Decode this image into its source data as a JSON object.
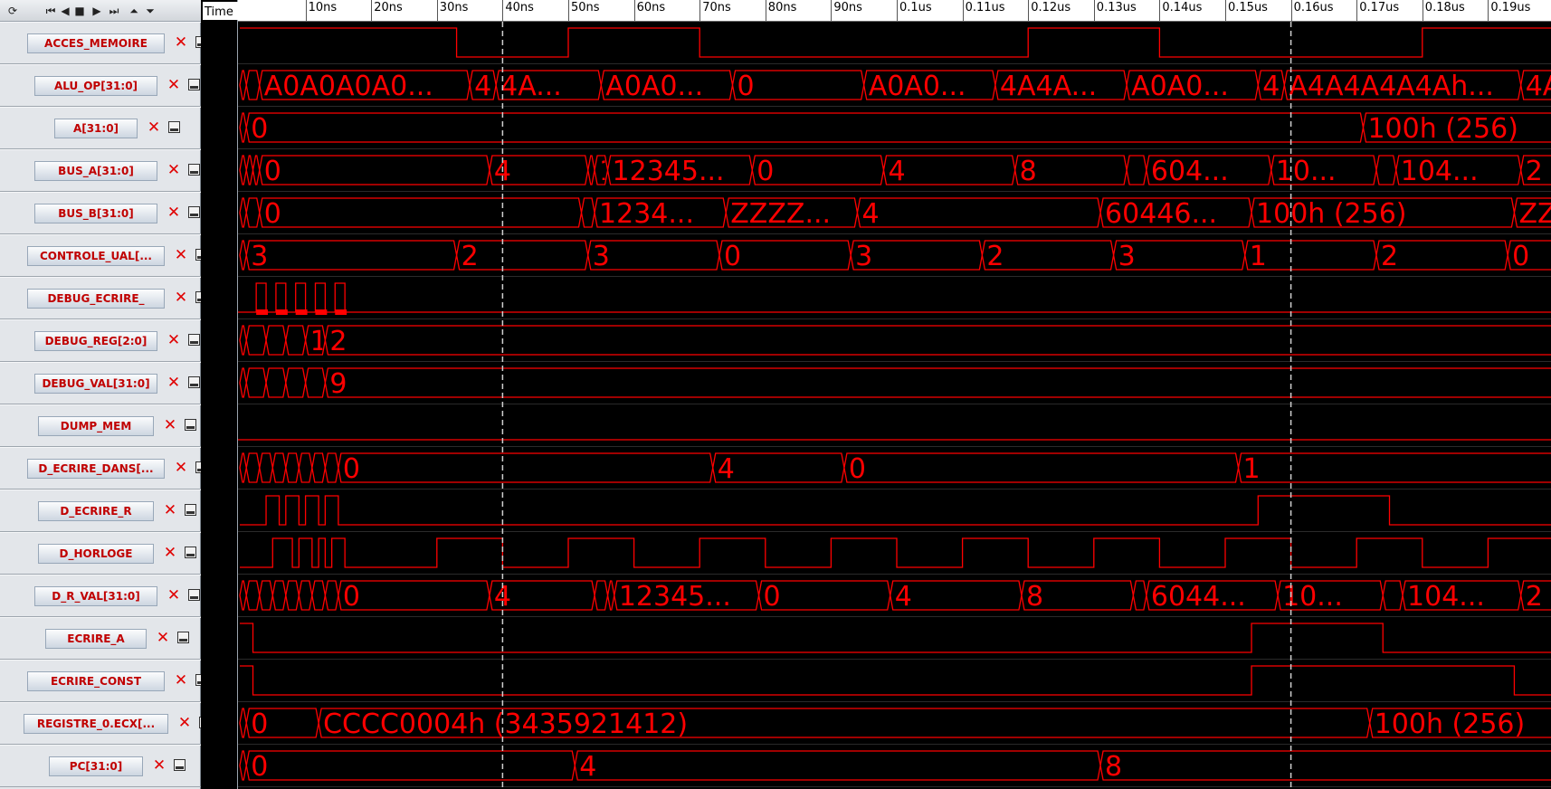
{
  "toolbar": {
    "buttons": [
      {
        "name": "refresh-icon",
        "glyph": "⟳"
      },
      {
        "name": "first-icon",
        "glyph": "⏮"
      },
      {
        "name": "prev-icon",
        "glyph": "◀"
      },
      {
        "name": "stop-icon",
        "glyph": "■"
      },
      {
        "name": "next-icon",
        "glyph": "▶"
      },
      {
        "name": "last-icon",
        "glyph": "⏭"
      },
      {
        "name": "move-up-icon",
        "glyph": "⏶"
      },
      {
        "name": "move-down-icon",
        "glyph": "⏷"
      }
    ]
  },
  "ruler": {
    "time_label": "Time",
    "ticks": [
      "10ns",
      "20ns",
      "30ns",
      "40ns",
      "50ns",
      "60ns",
      "70ns",
      "80ns",
      "90ns",
      "0.1us",
      "0.11us",
      "0.12us",
      "0.13us",
      "0.14us",
      "0.15us",
      "0.16us",
      "0.17us",
      "0.18us",
      "0.19us"
    ]
  },
  "time_range_ns": [
    0,
    205
  ],
  "cursors_ns": [
    40,
    160
  ],
  "colors": {
    "wave": "#ff0000",
    "background": "#000000",
    "label": "#c00000"
  },
  "signals": [
    {
      "name": "ACCES_MEMOIRE",
      "type": "bit",
      "edges": [
        [
          0,
          1
        ],
        [
          33,
          0
        ],
        [
          50,
          1
        ],
        [
          70,
          0
        ],
        [
          120,
          1
        ],
        [
          140,
          0
        ],
        [
          180,
          1
        ]
      ]
    },
    {
      "name": "ALU_OP[31:0]",
      "type": "bus",
      "segments": [
        [
          0,
          1,
          ""
        ],
        [
          1,
          3,
          ""
        ],
        [
          3,
          35,
          "A0A0A0A0A0A0A0A0h"
        ],
        [
          35,
          39,
          "4"
        ],
        [
          39,
          55,
          "4A4A4A4Ah"
        ],
        [
          55,
          75,
          "A0A0A0A0h"
        ],
        [
          75,
          95,
          "0"
        ],
        [
          95,
          115,
          "A0A0A0A0h"
        ],
        [
          115,
          135,
          "4A4A4A4Ah"
        ],
        [
          135,
          155,
          "A0A0A0A0h"
        ],
        [
          155,
          159,
          "4"
        ],
        [
          159,
          195,
          "A4A4A4A4Ah (2764...)"
        ],
        [
          195,
          205,
          "4A"
        ]
      ]
    },
    {
      "name": "A[31:0]",
      "type": "bus",
      "segments": [
        [
          0,
          1,
          ""
        ],
        [
          1,
          171,
          "0"
        ],
        [
          171,
          205,
          "100h (256)"
        ]
      ]
    },
    {
      "name": "BUS_A[31:0]",
      "type": "bus",
      "segments": [
        [
          0,
          1,
          ""
        ],
        [
          1,
          2,
          ""
        ],
        [
          2,
          3,
          ""
        ],
        [
          3,
          38,
          "0"
        ],
        [
          38,
          53,
          "4"
        ],
        [
          53,
          54,
          ""
        ],
        [
          54,
          56,
          "12345678h"
        ],
        [
          56,
          78,
          "12345678h"
        ],
        [
          78,
          98,
          "0"
        ],
        [
          98,
          118,
          "4"
        ],
        [
          118,
          135,
          "8"
        ],
        [
          135,
          138,
          ""
        ],
        [
          138,
          157,
          "60446044h"
        ],
        [
          157,
          173,
          "100h (256)"
        ],
        [
          173,
          176,
          ""
        ],
        [
          176,
          195,
          "104h (260)"
        ],
        [
          195,
          205,
          "2"
        ]
      ]
    },
    {
      "name": "BUS_B[31:0]",
      "type": "bus",
      "segments": [
        [
          0,
          1,
          ""
        ],
        [
          1,
          3,
          ""
        ],
        [
          3,
          52,
          "0"
        ],
        [
          52,
          54,
          ""
        ],
        [
          54,
          74,
          "12345678h"
        ],
        [
          74,
          94,
          "ZZZZZZZZh"
        ],
        [
          94,
          131,
          "4"
        ],
        [
          131,
          154,
          "60446044h"
        ],
        [
          154,
          194,
          "100h (256)"
        ],
        [
          194,
          205,
          "ZZ"
        ]
      ]
    },
    {
      "name": "CONTROLE_UAL[2:0]",
      "type": "bus",
      "segments": [
        [
          0,
          1,
          ""
        ],
        [
          1,
          33,
          "3"
        ],
        [
          33,
          53,
          "2"
        ],
        [
          53,
          73,
          "3"
        ],
        [
          73,
          93,
          "0"
        ],
        [
          93,
          113,
          "3"
        ],
        [
          113,
          133,
          "2"
        ],
        [
          133,
          153,
          "3"
        ],
        [
          153,
          173,
          "1"
        ],
        [
          173,
          193,
          "2"
        ],
        [
          193,
          205,
          "0"
        ]
      ]
    },
    {
      "name": "DEBUG_ECRIRE_",
      "type": "pulse",
      "pulses": [
        [
          2.5,
          4
        ],
        [
          5.5,
          7
        ],
        [
          8.5,
          10
        ],
        [
          11.5,
          13
        ],
        [
          14.5,
          16
        ]
      ]
    },
    {
      "name": "DEBUG_REG[2:0]",
      "type": "bus",
      "segments": [
        [
          0,
          1,
          ""
        ],
        [
          1,
          4,
          ""
        ],
        [
          4,
          7,
          ""
        ],
        [
          7,
          10,
          ""
        ],
        [
          10,
          13,
          "1"
        ],
        [
          13,
          205,
          "2"
        ]
      ]
    },
    {
      "name": "DEBUG_VAL[31:0]",
      "type": "bus",
      "segments": [
        [
          0,
          1,
          ""
        ],
        [
          1,
          4,
          ""
        ],
        [
          4,
          7,
          ""
        ],
        [
          7,
          10,
          ""
        ],
        [
          10,
          13,
          ""
        ],
        [
          13,
          205,
          "9"
        ]
      ]
    },
    {
      "name": "DUMP_MEM",
      "type": "low"
    },
    {
      "name": "D_ECRIRE_DANS[2:0]",
      "type": "bus",
      "segments": [
        [
          0,
          1,
          ""
        ],
        [
          1,
          3,
          ""
        ],
        [
          3,
          5,
          ""
        ],
        [
          5,
          7,
          ""
        ],
        [
          7,
          9,
          ""
        ],
        [
          9,
          11,
          ""
        ],
        [
          11,
          13,
          ""
        ],
        [
          13,
          15,
          ""
        ],
        [
          15,
          72,
          "0"
        ],
        [
          72,
          92,
          "4"
        ],
        [
          92,
          152,
          "0"
        ],
        [
          152,
          205,
          "1"
        ]
      ]
    },
    {
      "name": "D_ECRIRE_R",
      "type": "bit",
      "edges": [
        [
          0,
          0
        ],
        [
          4,
          1
        ],
        [
          6,
          0
        ],
        [
          7,
          1
        ],
        [
          9,
          0
        ],
        [
          10,
          1
        ],
        [
          12,
          0
        ],
        [
          13,
          1
        ],
        [
          15,
          0
        ],
        [
          155,
          1
        ],
        [
          175,
          0
        ]
      ]
    },
    {
      "name": "D_HORLOGE",
      "type": "bit",
      "edges": [
        [
          0,
          0
        ],
        [
          5,
          1
        ],
        [
          8,
          0
        ],
        [
          9,
          1
        ],
        [
          11,
          0
        ],
        [
          12,
          1
        ],
        [
          13,
          0
        ],
        [
          14,
          1
        ],
        [
          16,
          0
        ],
        [
          30,
          1
        ],
        [
          40,
          0
        ],
        [
          50,
          1
        ],
        [
          60,
          0
        ],
        [
          70,
          1
        ],
        [
          80,
          0
        ],
        [
          90,
          1
        ],
        [
          100,
          0
        ],
        [
          110,
          1
        ],
        [
          120,
          0
        ],
        [
          130,
          1
        ],
        [
          140,
          0
        ],
        [
          150,
          1
        ],
        [
          160,
          0
        ],
        [
          170,
          1
        ],
        [
          180,
          0
        ],
        [
          190,
          1
        ],
        [
          200,
          0
        ]
      ]
    },
    {
      "name": "D_R_VAL[31:0]",
      "type": "bus",
      "segments": [
        [
          0,
          1,
          ""
        ],
        [
          1,
          3,
          ""
        ],
        [
          3,
          5,
          ""
        ],
        [
          5,
          7,
          ""
        ],
        [
          7,
          9,
          ""
        ],
        [
          9,
          11,
          ""
        ],
        [
          11,
          13,
          ""
        ],
        [
          13,
          15,
          ""
        ],
        [
          15,
          38,
          "0"
        ],
        [
          38,
          54,
          "4"
        ],
        [
          54,
          56,
          ""
        ],
        [
          56,
          57,
          ""
        ],
        [
          57,
          79,
          "12345678h"
        ],
        [
          79,
          99,
          "0"
        ],
        [
          99,
          119,
          "4"
        ],
        [
          119,
          136,
          "8"
        ],
        [
          136,
          138,
          ""
        ],
        [
          138,
          158,
          "60446044h"
        ],
        [
          158,
          174,
          "100h (256)"
        ],
        [
          174,
          177,
          ""
        ],
        [
          177,
          195,
          "104h (260)"
        ],
        [
          195,
          205,
          "2"
        ]
      ]
    },
    {
      "name": "ECRIRE_A",
      "type": "bit",
      "edges": [
        [
          0,
          1
        ],
        [
          2,
          0
        ],
        [
          154,
          1
        ],
        [
          174,
          0
        ]
      ]
    },
    {
      "name": "ECRIRE_CONST",
      "type": "bit",
      "edges": [
        [
          0,
          1
        ],
        [
          2,
          0
        ],
        [
          154,
          1
        ],
        [
          194,
          0
        ]
      ]
    },
    {
      "name": "REGISTRE_0.ECX[31:0]",
      "type": "bus",
      "segments": [
        [
          0,
          1,
          ""
        ],
        [
          1,
          12,
          "0"
        ],
        [
          12,
          172,
          "CCCC0004h (3435921412)"
        ],
        [
          172,
          205,
          "100h (256)"
        ]
      ]
    },
    {
      "name": "PC[31:0]",
      "type": "bus",
      "segments": [
        [
          0,
          1,
          ""
        ],
        [
          1,
          51,
          "0"
        ],
        [
          51,
          131,
          "4"
        ],
        [
          131,
          205,
          "8"
        ]
      ]
    }
  ],
  "sidebar_labels": [
    "ACCES_MEMOIRE",
    "ALU_OP[31:0]",
    "A[31:0]",
    "BUS_A[31:0]",
    "BUS_B[31:0]",
    "CONTROLE_UAL[...",
    "DEBUG_ECRIRE_",
    "DEBUG_REG[2:0]",
    "DEBUG_VAL[31:0]",
    "DUMP_MEM",
    "D_ECRIRE_DANS[...",
    "D_ECRIRE_R",
    "D_HORLOGE",
    "D_R_VAL[31:0]",
    "ECRIRE_A",
    "ECRIRE_CONST",
    "REGISTRE_0.ECX[...",
    "PC[31:0]"
  ]
}
